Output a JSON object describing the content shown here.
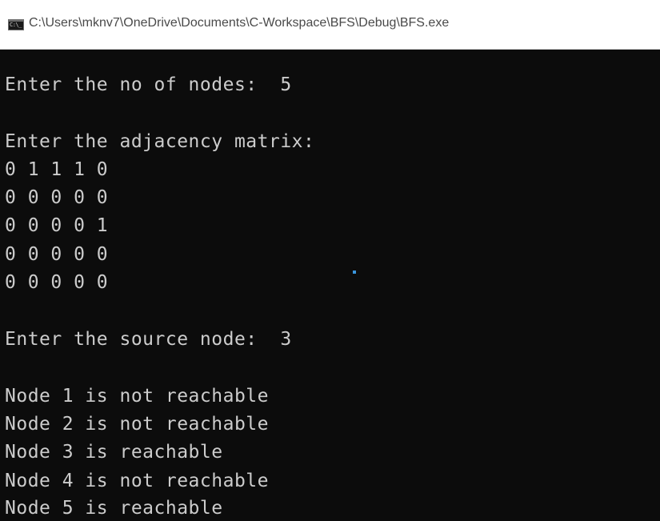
{
  "window": {
    "title": "C:\\Users\\mknv7\\OneDrive\\Documents\\C-Workspace\\BFS\\Debug\\BFS.exe",
    "icon_label": "C:\\_"
  },
  "console": {
    "lines": [
      "Enter the no of nodes:  5",
      "Enter the adjacency matrix:",
      "0 1 1 1 0",
      "0 0 0 0 0",
      "0 0 0 0 1",
      "0 0 0 0 0",
      "0 0 0 0 0",
      "Enter the source node:  3",
      "Node 1 is not reachable",
      "Node 2 is not reachable",
      "Node 3 is reachable",
      "Node 4 is not reachable",
      "Node 5 is reachable"
    ]
  },
  "colors": {
    "console_background": "#0c0c0c",
    "console_text": "#cccccc",
    "titlebar_background": "#ffffff",
    "title_text": "#4a4a4a"
  }
}
